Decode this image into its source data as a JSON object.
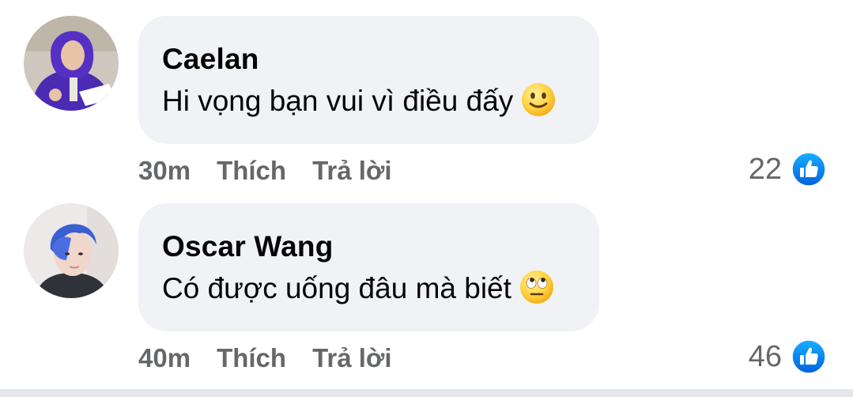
{
  "comments": [
    {
      "author": "Caelan",
      "text": "Hi vọng bạn vui vì điều đấy",
      "emoji": "slightly-smiling-face",
      "time": "30m",
      "like_label": "Thích",
      "reply_label": "Trả lời",
      "reaction_count": "22",
      "reaction_icon": "thumbs-up-icon",
      "accent": "#1877f2"
    },
    {
      "author": "Oscar Wang",
      "text": "Có được uống đâu mà biết",
      "emoji": "face-with-rolling-eyes",
      "time": "40m",
      "like_label": "Thích",
      "reply_label": "Trả lời",
      "reaction_count": "46",
      "reaction_icon": "thumbs-up-icon",
      "accent": "#1877f2"
    }
  ]
}
